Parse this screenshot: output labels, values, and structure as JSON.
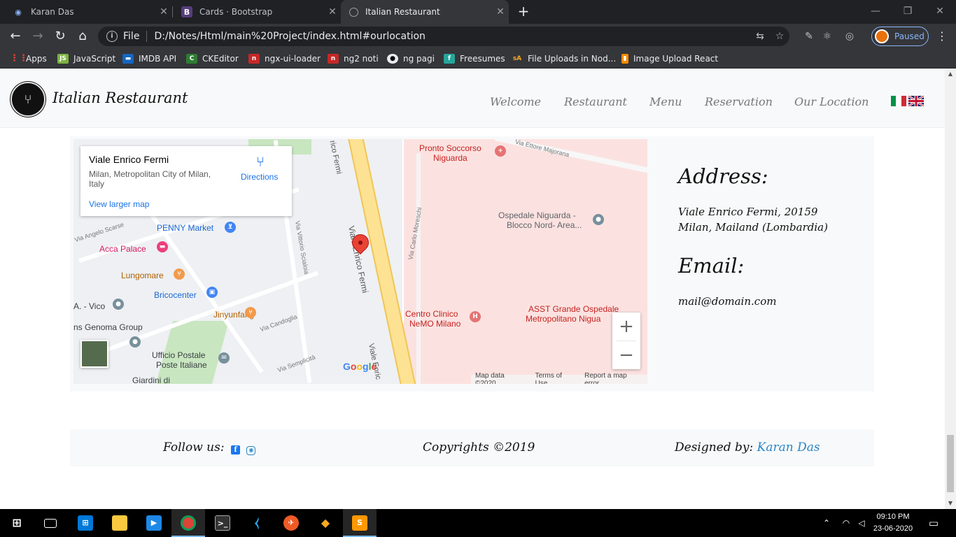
{
  "browser": {
    "tabs": [
      {
        "title": "Karan Das",
        "favicon": "location-pin-icon"
      },
      {
        "title": "Cards · Bootstrap",
        "favicon": "bootstrap-icon"
      },
      {
        "title": "Italian Restaurant",
        "favicon": "globe-icon"
      }
    ],
    "url_scheme": "File",
    "url": "D:/Notes/Html/main%20Project/index.html#ourlocation",
    "profile_label": "Paused",
    "bookmarks": [
      {
        "label": "Apps",
        "icon": "apps-grid-icon",
        "color": "#4285f4"
      },
      {
        "label": "JavaScript",
        "icon": "javascript-icon",
        "color": "#7cb342"
      },
      {
        "label": "IMDB API",
        "icon": "imdb-icon",
        "color": "#1565c0"
      },
      {
        "label": "CKEditor",
        "icon": "ckeditor-icon",
        "color": "#2e7d32"
      },
      {
        "label": "ngx-ui-loader",
        "icon": "npm-icon",
        "color": "#c62828"
      },
      {
        "label": "ng2 noti",
        "icon": "npm-icon",
        "color": "#c62828"
      },
      {
        "label": "ng pagi",
        "icon": "github-icon",
        "color": "#e8eaed"
      },
      {
        "label": "Freesumes",
        "icon": "freesumes-icon",
        "color": "#26a69a"
      },
      {
        "label": "File Uploads in Nod...",
        "icon": "sa-icon",
        "color": "#f9a825"
      },
      {
        "label": "Image Upload React",
        "icon": "bookmark-icon",
        "color": "#fb8c00"
      }
    ]
  },
  "site": {
    "brand": "Italian Restaurant",
    "nav": [
      "Welcome",
      "Restaurant",
      "Menu",
      "Reservation",
      "Our Location"
    ],
    "flags": [
      "italy-flag-icon",
      "uk-flag-icon"
    ]
  },
  "map": {
    "place_name": "Viale Enrico Fermi",
    "place_address": "Milan, Metropolitan City of Milan, Italy",
    "directions_label": "Directions",
    "larger_map_label": "View larger map",
    "labels": {
      "pronto": "Pronto Soccorso",
      "niguarda": "Niguarda",
      "ettore": "Via Ettore Majorana",
      "fermi_top": "rico Fermi",
      "fermi_mid": "Viale Enrico Fermi",
      "fermi_bottom": "Viale Enric",
      "moreschi": "Via Carlo Moreschi",
      "ospedale": "Ospedale Niguarda -",
      "blocco": "Blocco Nord- Area...",
      "penny": "PENNY Market",
      "acca": "Acca Palace",
      "lungomare": "Lungomare",
      "bricocenter": "Bricocenter",
      "vico": "A. - Vico",
      "genoma": "ns Genoma Group",
      "jinyunfang": "Jinyunfang",
      "candoglia": "Via Candoglia",
      "scialoia": "Via Vittorio Scialoia",
      "scarsellini": "Via Angelo Scarse",
      "ufficio": "Ufficio Postale",
      "poste": "Poste Italiane",
      "semplicita": "Via Semplicità",
      "giardini": "Giardini di",
      "centro_clinico": "Centro Clinico",
      "nemo": "NeMO Milano",
      "asst": "ASST Grande Ospedale",
      "metropolitano": "Metropolitano Nigua"
    },
    "google_letters": [
      "G",
      "o",
      "o",
      "g",
      "l",
      "e"
    ],
    "attribution": [
      "Map data ©2020",
      "Terms of Use",
      "Report a map error"
    ],
    "zoom_in": "+",
    "zoom_out": "−"
  },
  "contact": {
    "address_heading": "Address:",
    "address_line1": "Viale Enrico Fermi, 20159",
    "address_line2": "Milan, Mailand (Lombardia)",
    "email_heading": "Email:",
    "email": "mail@domain.com"
  },
  "footer": {
    "follow_label": "Follow us:",
    "copyright": "Copyrights ©2019",
    "designed_label": "Designed by:",
    "designer": "Karan Das"
  },
  "taskbar": {
    "time": "09:10 PM",
    "date": "23-06-2020"
  },
  "colors": {
    "accent_link": "#2a87c8",
    "facebook": "#1877f2",
    "instagram": "#2a87c8",
    "map_pin": "#ea4335"
  }
}
